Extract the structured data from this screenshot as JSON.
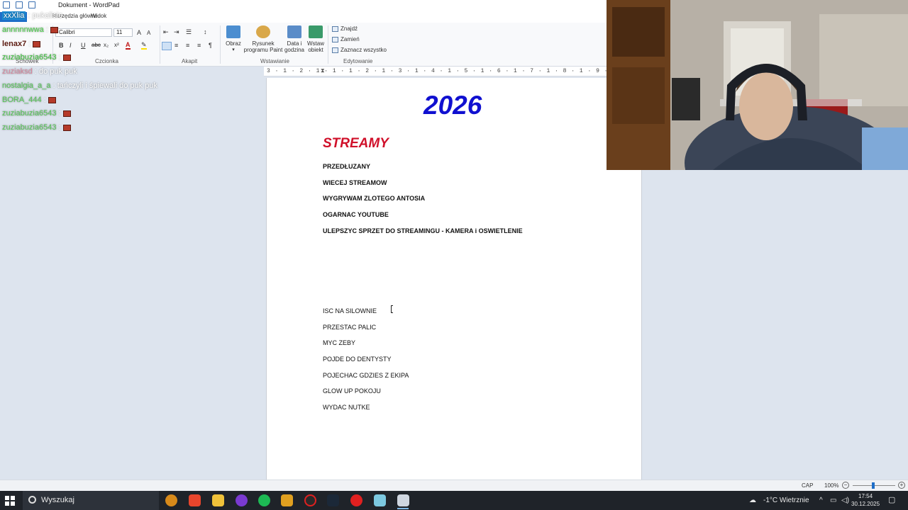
{
  "window": {
    "title": "Dokument - WordPad"
  },
  "ribbon": {
    "tabs": [
      "Plik",
      "Narzędzia główne",
      "Widok"
    ],
    "font_name": "Calibri",
    "font_size": "11",
    "groups": {
      "clipboard": "Schowek",
      "font": "Czcionka",
      "paragraph": "Akapit",
      "insert": "Wstawianie",
      "editing": "Edytowanie"
    },
    "insert_buttons": {
      "picture": "Obraz",
      "paint_line1": "Rysunek",
      "paint_line2": "programu Paint",
      "datetime_line1": "Data i",
      "datetime_line2": "godzina",
      "object_line1": "Wstaw",
      "object_line2": "obiekt"
    },
    "editing_buttons": {
      "find": "Znajdź",
      "replace": "Zamień",
      "select_all": "Zaznacz wszystko"
    }
  },
  "ruler": {
    "text": "3 · 1 · 2 · 1 · 1 · 1 · 2 · 1 · 3 · 1 · 4 · 1 · 5 · 1 · 6 · 1 · 7 · 1 · 8 · 1 · 9 · 1 · 10 · 1 · 11 · 1 · 12 · 1 · 13 · 1 · 14 · 15 ·"
  },
  "document": {
    "year": "2026",
    "heading": "STREAMY",
    "stream_goals": [
      "PRZEDŁUZANY",
      "WIECEJ STREAMOW",
      "WYGRYWAM ZLOTEGO ANTOSIA",
      "OGARNAC YOUTUBE",
      "ULEPSZYC SPRZET DO STREAMINGU - KAMERA i OSWIETLENIE"
    ],
    "personal_goals": [
      "ISC NA SILOWNIE",
      "PRZESTAC PALIC",
      "MYC ZEBY",
      "POJDE DO DENTYSTY",
      "POJECHAC GDZIES Z EKIPA",
      "GLOW UP POKOJU",
      "WYDAC NUTKE"
    ]
  },
  "chat": [
    {
      "user": "xxXlia",
      "text": "pukalisie",
      "user_color": "#8fe0ff",
      "text_color": "#ffffff",
      "emote": false
    },
    {
      "user": "annnnnwwa",
      "text": "",
      "user_color": "#4ad04a",
      "text_color": "#ffffff",
      "emote": true
    },
    {
      "user": "lenax7",
      "text": "",
      "user_color": "#5a1a10",
      "text_color": "#ffffff",
      "emote": true
    },
    {
      "user": "zuziabuzia6543",
      "text": "",
      "user_color": "#3ac23a",
      "text_color": "#ffffff",
      "emote": true
    },
    {
      "user": "zuziaksd",
      "text": "do puk puk",
      "user_color": "#d98aa0",
      "text_color": "#ffffff",
      "emote": false
    },
    {
      "user": "nostalgia_a_a",
      "text": "tańczyli i śpiewali do puk puk",
      "user_color": "#58c858",
      "text_color": "#ffffff",
      "emote": false
    },
    {
      "user": "BORA_444",
      "text": "",
      "user_color": "#58c858",
      "text_color": "#ffffff",
      "emote": true
    },
    {
      "user": "zuziabuzia6543",
      "text": "",
      "user_color": "#58c858",
      "text_color": "#ffffff",
      "emote": true
    },
    {
      "user": "zuziabuzia6543",
      "text": "",
      "user_color": "#58c858",
      "text_color": "#ffffff",
      "emote": true
    }
  ],
  "statusbar": {
    "caps": "CAP",
    "zoom": "100%",
    "zoom_level": 0.5
  },
  "taskbar": {
    "search_placeholder": "Wyszukaj",
    "weather": "-1°C  Wietrznie",
    "time": "17:54",
    "date": "30.12.2025"
  },
  "colors": {
    "accent": "#1e6ec8",
    "year_color": "#1010d0",
    "heading_color": "#d0102a"
  }
}
